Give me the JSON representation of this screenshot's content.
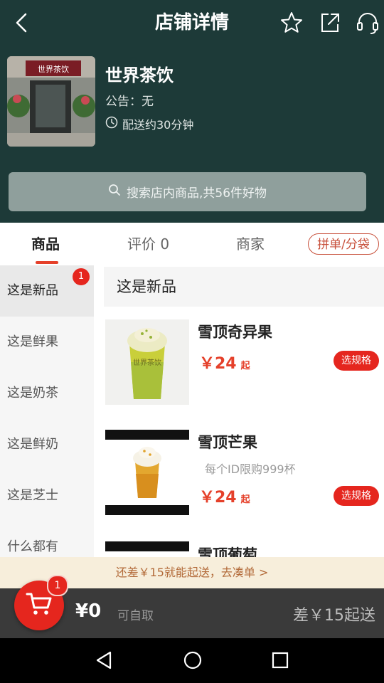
{
  "header": {
    "title": "店铺详情",
    "icons": [
      "back-arrow-icon",
      "star-icon",
      "share-icon",
      "headset-icon"
    ]
  },
  "store": {
    "name": "世界茶饮",
    "notice": "公告：无",
    "delivery": "配送约30分钟",
    "sign_text": "世界茶饮"
  },
  "search": {
    "placeholder": "搜索店内商品,共56件好物"
  },
  "tabs": [
    {
      "label": "商品",
      "active": true
    },
    {
      "label": "评价 0"
    },
    {
      "label": "商家"
    }
  ],
  "group_button": "拼单/分袋",
  "categories": [
    {
      "label": "这是新品",
      "active": true,
      "badge": "1"
    },
    {
      "label": "这是鲜果"
    },
    {
      "label": "这是奶茶"
    },
    {
      "label": "这是鲜奶"
    },
    {
      "label": "这是芝士"
    },
    {
      "label": "什么都有"
    }
  ],
  "section_title": "这是新品",
  "products": [
    {
      "name": "雪顶奇异果",
      "price": "￥24",
      "price_suffix": "起",
      "button": "选规格",
      "limit": ""
    },
    {
      "name": "雪顶芒果",
      "price": "￥24",
      "price_suffix": "起",
      "button": "选规格",
      "limit": "每个ID限购999杯"
    },
    {
      "name": "雪顶葡萄",
      "price": "",
      "price_suffix": "",
      "button": "",
      "limit": ""
    }
  ],
  "threshold_tip": "还差￥15就能起送，去凑单 >",
  "cart": {
    "badge": "1",
    "amount": "¥0",
    "pickup": "可自取",
    "min_order": "差￥15起送"
  },
  "colors": {
    "header_bg": "#1d3a38",
    "accent_red": "#e5261e",
    "price_red": "#e5402a",
    "tip_bg": "#f7eedb",
    "cart_bar": "#3a3a3a"
  }
}
